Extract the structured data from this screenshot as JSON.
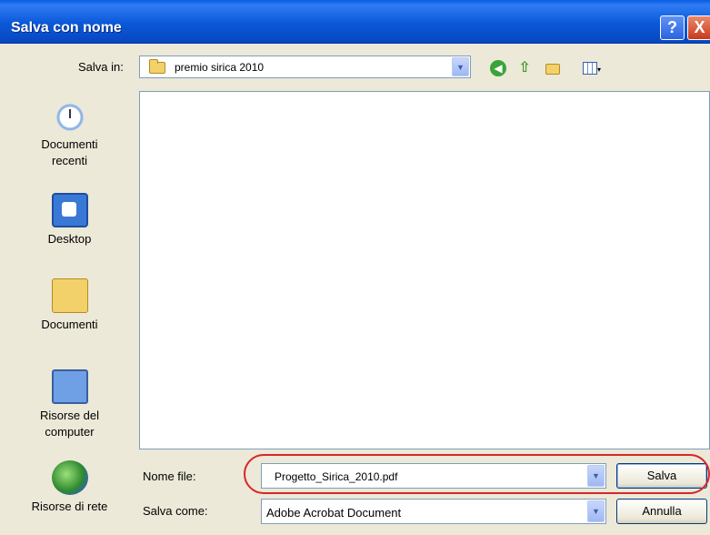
{
  "window": {
    "title": "Salva con nome",
    "help_label": "?",
    "close_label": "X"
  },
  "toolbar": {
    "save_in_label": "Salva in:",
    "save_in_value": "premio sirica 2010",
    "dropdown_glyph": "▼",
    "back_glyph": "◀",
    "up_glyph": "⇧",
    "views_arrow": "▾"
  },
  "places": [
    {
      "label_line1": "Documenti",
      "label_line2": "recenti",
      "icon": "recent-documents-icon"
    },
    {
      "label_line1": "Desktop",
      "label_line2": "",
      "icon": "desktop-icon"
    },
    {
      "label_line1": "Documenti",
      "label_line2": "",
      "icon": "my-documents-icon"
    },
    {
      "label_line1": "Risorse del",
      "label_line2": "computer",
      "icon": "my-computer-icon"
    },
    {
      "label_line1": "Risorse di rete",
      "label_line2": "",
      "icon": "network-places-icon"
    }
  ],
  "form": {
    "filename_label": "Nome file:",
    "filename_value": "Progetto_Sirica_2010.pdf",
    "savetype_label": "Salva come:",
    "savetype_value": "Adobe Acrobat Document",
    "save_button": "Salva",
    "cancel_button": "Annulla"
  },
  "colors": {
    "titlebar": "#0a58d8",
    "highlight_outline": "#d8262a",
    "dialog_background": "#ece9d8"
  }
}
